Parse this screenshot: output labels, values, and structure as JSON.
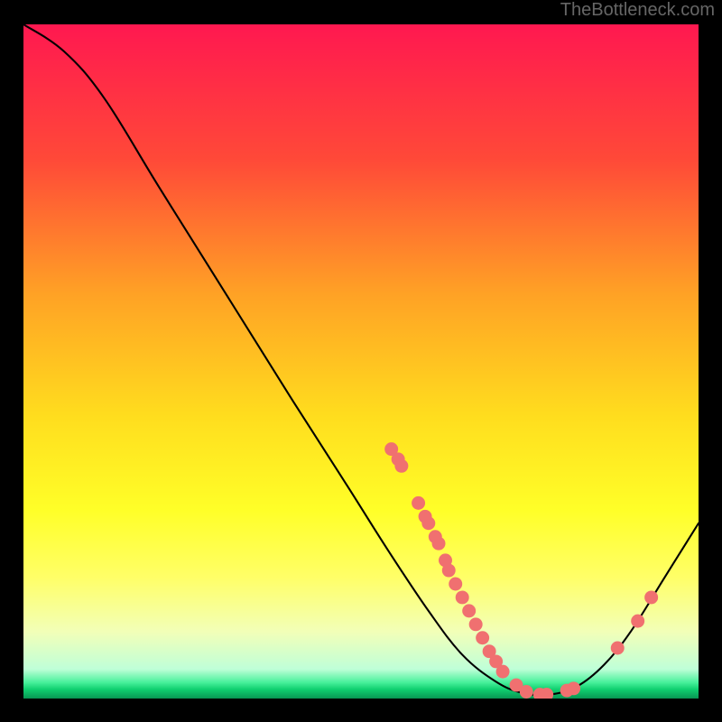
{
  "attribution": "TheBottleneck.com",
  "chart_data": {
    "type": "line",
    "title": "",
    "xlabel": "",
    "ylabel": "",
    "xlim": [
      0,
      100
    ],
    "ylim": [
      0,
      100
    ],
    "curve": [
      {
        "x": 0.0,
        "y": 100.0
      },
      {
        "x": 6.0,
        "y": 96.0
      },
      {
        "x": 12.0,
        "y": 89.0
      },
      {
        "x": 20.0,
        "y": 76.0
      },
      {
        "x": 30.0,
        "y": 60.0
      },
      {
        "x": 40.0,
        "y": 44.0
      },
      {
        "x": 48.0,
        "y": 31.5
      },
      {
        "x": 54.0,
        "y": 22.0
      },
      {
        "x": 60.0,
        "y": 13.0
      },
      {
        "x": 65.0,
        "y": 6.5
      },
      {
        "x": 70.0,
        "y": 2.5
      },
      {
        "x": 74.0,
        "y": 0.8
      },
      {
        "x": 78.0,
        "y": 0.6
      },
      {
        "x": 82.0,
        "y": 1.8
      },
      {
        "x": 86.0,
        "y": 5.0
      },
      {
        "x": 90.0,
        "y": 10.0
      },
      {
        "x": 95.0,
        "y": 18.0
      },
      {
        "x": 100.0,
        "y": 26.0
      }
    ],
    "markers": [
      {
        "x": 54.5,
        "y": 37.0
      },
      {
        "x": 55.5,
        "y": 35.5
      },
      {
        "x": 56.0,
        "y": 34.5
      },
      {
        "x": 58.5,
        "y": 29.0
      },
      {
        "x": 59.5,
        "y": 27.0
      },
      {
        "x": 60.0,
        "y": 26.0
      },
      {
        "x": 61.0,
        "y": 24.0
      },
      {
        "x": 61.5,
        "y": 23.0
      },
      {
        "x": 62.5,
        "y": 20.5
      },
      {
        "x": 63.0,
        "y": 19.0
      },
      {
        "x": 64.0,
        "y": 17.0
      },
      {
        "x": 65.0,
        "y": 15.0
      },
      {
        "x": 66.0,
        "y": 13.0
      },
      {
        "x": 67.0,
        "y": 11.0
      },
      {
        "x": 68.0,
        "y": 9.0
      },
      {
        "x": 69.0,
        "y": 7.0
      },
      {
        "x": 70.0,
        "y": 5.5
      },
      {
        "x": 71.0,
        "y": 4.0
      },
      {
        "x": 73.0,
        "y": 2.0
      },
      {
        "x": 74.5,
        "y": 1.0
      },
      {
        "x": 76.5,
        "y": 0.6
      },
      {
        "x": 77.5,
        "y": 0.6
      },
      {
        "x": 80.5,
        "y": 1.2
      },
      {
        "x": 81.5,
        "y": 1.5
      },
      {
        "x": 88.0,
        "y": 7.5
      },
      {
        "x": 91.0,
        "y": 11.5
      },
      {
        "x": 93.0,
        "y": 15.0
      }
    ],
    "gradient_stops": [
      {
        "pos": 0.0,
        "color": "#ff1850"
      },
      {
        "pos": 0.2,
        "color": "#ff4938"
      },
      {
        "pos": 0.4,
        "color": "#ffa225"
      },
      {
        "pos": 0.58,
        "color": "#ffdd1e"
      },
      {
        "pos": 0.72,
        "color": "#ffff28"
      },
      {
        "pos": 0.82,
        "color": "#ffff68"
      },
      {
        "pos": 0.9,
        "color": "#f2ffb8"
      },
      {
        "pos": 0.955,
        "color": "#bfffd8"
      },
      {
        "pos": 0.975,
        "color": "#46f09a"
      },
      {
        "pos": 0.985,
        "color": "#10d070"
      },
      {
        "pos": 1.0,
        "color": "#079050"
      }
    ],
    "marker_color": "#f07070",
    "curve_color": "#000000"
  }
}
